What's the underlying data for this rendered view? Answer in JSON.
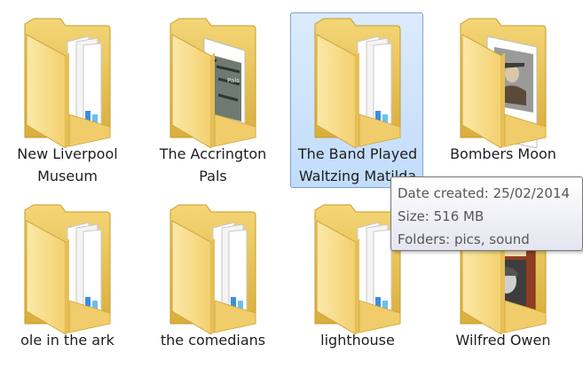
{
  "folders": [
    {
      "name": "New Liverpool\nMuseum",
      "thumbnail": "documents"
    },
    {
      "name": "The Accrington\nPals",
      "thumbnail": "hummingbird-photo"
    },
    {
      "name": "The Band Played\nWaltzing Matilda",
      "thumbnail": "documents",
      "selected": true
    },
    {
      "name": "Bombers Moon",
      "thumbnail": "soldier-photo"
    },
    {
      "name": "ole in the ark",
      "thumbnail": "documents"
    },
    {
      "name": "the comedians",
      "thumbnail": "documents"
    },
    {
      "name": "lighthouse",
      "thumbnail": "documents"
    },
    {
      "name": "Wilfred Owen",
      "thumbnail": "book-cover-portrait"
    }
  ],
  "tooltip": {
    "date_created": "Date created: 25/02/2014",
    "size": "Size: 516 MB",
    "folders": "Folders: pics, sound"
  },
  "colors": {
    "folder_back": "#e8c35a",
    "folder_front": "#fbe49a",
    "selection_fill": "#cde3fc",
    "selection_border": "#7da2ce"
  }
}
